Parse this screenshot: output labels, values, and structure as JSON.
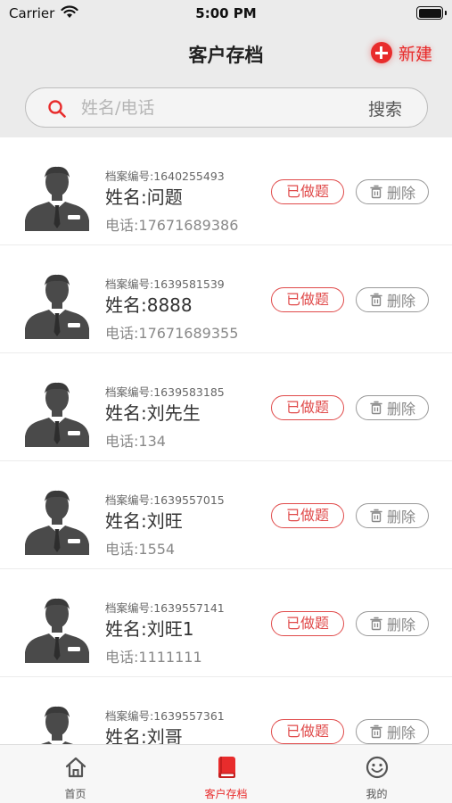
{
  "status_bar": {
    "carrier": "Carrier",
    "time": "5:00 PM"
  },
  "header": {
    "title": "客户存档",
    "new_label": "新建"
  },
  "search": {
    "placeholder": "姓名/电话",
    "button_label": "搜索"
  },
  "customers": [
    {
      "file_no": "档案编号:1640255493",
      "name": "姓名:问题",
      "phone": "电话:17671689386",
      "status": "已做题",
      "delete": "删除"
    },
    {
      "file_no": "档案编号:1639581539",
      "name": "姓名:8888",
      "phone": "电话:17671689355",
      "status": "已做题",
      "delete": "删除"
    },
    {
      "file_no": "档案编号:1639583185",
      "name": "姓名:刘先生",
      "phone": "电话:134",
      "status": "已做题",
      "delete": "删除"
    },
    {
      "file_no": "档案编号:1639557015",
      "name": "姓名:刘旺",
      "phone": "电话:1554",
      "status": "已做题",
      "delete": "删除"
    },
    {
      "file_no": "档案编号:1639557141",
      "name": "姓名:刘旺1",
      "phone": "电话:1111111",
      "status": "已做题",
      "delete": "删除"
    },
    {
      "file_no": "档案编号:1639557361",
      "name": "姓名:刘哥",
      "phone": "",
      "status": "已做题",
      "delete": "删除"
    }
  ],
  "tab_bar": {
    "tabs": [
      {
        "label": "首页",
        "icon": "home-icon",
        "active": false
      },
      {
        "label": "客户存档",
        "icon": "book-icon",
        "active": true
      },
      {
        "label": "我的",
        "icon": "smiley-icon",
        "active": false
      }
    ]
  },
  "colors": {
    "accent": "#e82c2c",
    "background": "#ebebeb"
  }
}
